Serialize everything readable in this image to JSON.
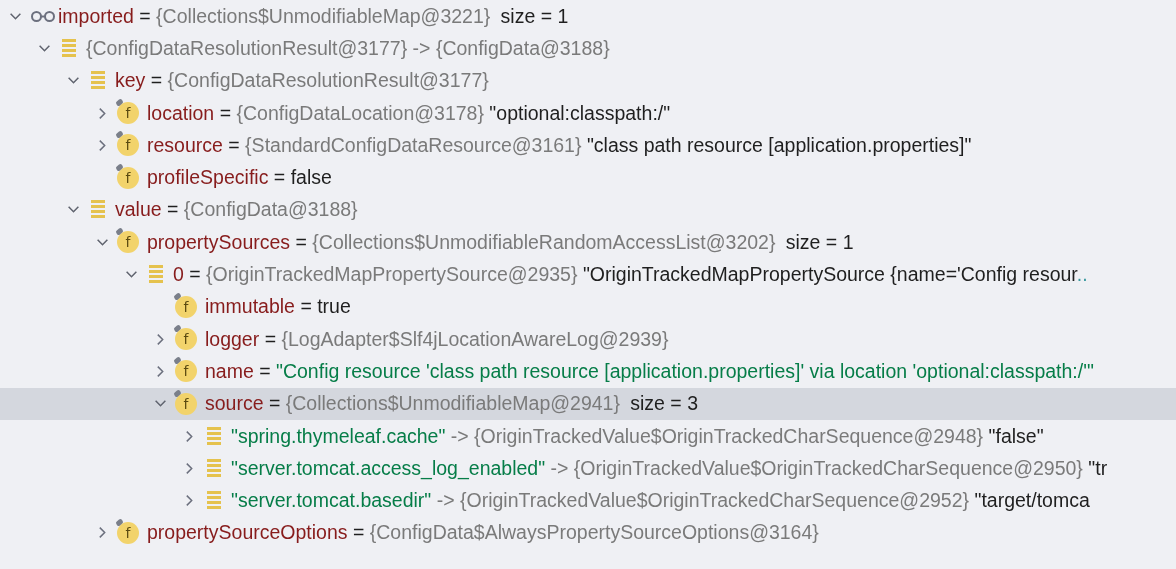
{
  "variables": [
    {
      "kind": "watch",
      "expanded": true,
      "selected": false,
      "name": "imported",
      "separator": "=",
      "ref": "{Collections$UnmodifiableMap@3221}",
      "size": "size = 1",
      "children": [
        {
          "kind": "entry",
          "expanded": true,
          "selected": false,
          "ref": "{ConfigDataResolutionResult@3177}",
          "arrow": "->",
          "target": "{ConfigData@3188}",
          "children": [
            {
              "kind": "entry",
              "expanded": true,
              "selected": false,
              "name": "key",
              "separator": "=",
              "ref": "{ConfigDataResolutionResult@3177}",
              "children": [
                {
                  "kind": "field",
                  "icon_text": "f",
                  "expanded": false,
                  "selected": false,
                  "name": "location",
                  "separator": "=",
                  "ref": "{ConfigDataLocation@3178}",
                  "value": "\"optional:classpath:/\""
                },
                {
                  "kind": "field",
                  "icon_text": "f",
                  "expanded": false,
                  "selected": false,
                  "name": "resource",
                  "separator": "=",
                  "ref": "{StandardConfigDataResource@3161}",
                  "value": "\"class path resource [application.properties]\""
                },
                {
                  "kind": "field",
                  "icon_text": "f",
                  "selected": false,
                  "name": "profileSpecific",
                  "separator": "=",
                  "value": "false"
                }
              ]
            },
            {
              "kind": "entry",
              "expanded": true,
              "selected": false,
              "name": "value",
              "separator": "=",
              "ref": "{ConfigData@3188}",
              "children": [
                {
                  "kind": "field",
                  "icon_text": "f",
                  "expanded": true,
                  "selected": false,
                  "name": "propertySources",
                  "separator": "=",
                  "ref": "{Collections$UnmodifiableRandomAccessList@3202}",
                  "size": "size = 1",
                  "children": [
                    {
                      "kind": "entry",
                      "expanded": true,
                      "selected": false,
                      "name": "0",
                      "separator": "=",
                      "ref": "{OriginTrackedMapPropertySource@2935}",
                      "value": "\"OriginTrackedMapPropertySource {name='Config resour",
                      "more": "..",
                      "children": [
                        {
                          "kind": "field",
                          "icon_text": "f",
                          "selected": false,
                          "name": "immutable",
                          "separator": "=",
                          "value": "true"
                        },
                        {
                          "kind": "field",
                          "icon_text": "f",
                          "expanded": false,
                          "selected": false,
                          "name": "logger",
                          "separator": "=",
                          "ref": "{LogAdapter$Slf4jLocationAwareLog@2939}"
                        },
                        {
                          "kind": "field",
                          "icon_text": "f",
                          "expanded": false,
                          "selected": false,
                          "name": "name",
                          "separator": "=",
                          "string_value": "\"Config resource 'class path resource [application.properties]' via location 'optional:classpath:/'\""
                        },
                        {
                          "kind": "field",
                          "icon_text": "f",
                          "expanded": true,
                          "selected": true,
                          "name": "source",
                          "separator": "=",
                          "ref": "{Collections$UnmodifiableMap@2941}",
                          "size": "size = 3",
                          "children": [
                            {
                              "kind": "entry",
                              "expanded": false,
                              "selected": false,
                              "key": "\"spring.thymeleaf.cache\"",
                              "arrow": "->",
                              "target": "{OriginTrackedValue$OriginTrackedCharSequence@2948}",
                              "value": "\"false\""
                            },
                            {
                              "kind": "entry",
                              "expanded": false,
                              "selected": false,
                              "key": "\"server.tomcat.access_log_enabled\"",
                              "arrow": "->",
                              "target": "{OriginTrackedValue$OriginTrackedCharSequence@2950}",
                              "value": "\"tr"
                            },
                            {
                              "kind": "entry",
                              "expanded": false,
                              "selected": false,
                              "key": "\"server.tomcat.basedir\"",
                              "arrow": "->",
                              "target": "{OriginTrackedValue$OriginTrackedCharSequence@2952}",
                              "value": "\"target/tomca"
                            }
                          ]
                        }
                      ]
                    }
                  ]
                },
                {
                  "kind": "field",
                  "icon_text": "f",
                  "expanded": false,
                  "selected": false,
                  "name": "propertySourceOptions",
                  "separator": "=",
                  "ref": "{ConfigData$AlwaysPropertySourceOptions@3164}"
                }
              ]
            }
          ]
        }
      ]
    }
  ]
}
